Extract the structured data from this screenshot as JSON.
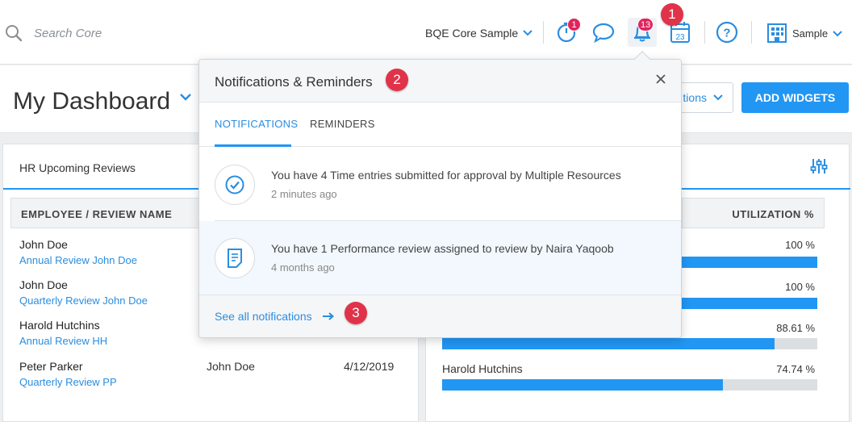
{
  "search": {
    "placeholder": "Search Core"
  },
  "header": {
    "company": "BQE Core Sample",
    "user": "Sample",
    "timer_badge": "1",
    "notif_badge": "13"
  },
  "callouts": {
    "one": "1",
    "two": "2",
    "three": "3"
  },
  "dashboard": {
    "title": "My Dashboard",
    "options_label": "tions",
    "add_widgets": "ADD WIDGETS"
  },
  "hr_widget": {
    "title": "HR Upcoming Reviews",
    "column_header": "EMPLOYEE / REVIEW NAME",
    "rows": [
      {
        "employee": "John Doe",
        "review": "Annual Review John Doe"
      },
      {
        "employee": "John Doe",
        "review": "Quarterly Review John Doe"
      },
      {
        "employee": "Harold Hutchins",
        "review": "Annual Review HH"
      },
      {
        "employee": "Peter Parker",
        "review": "Quarterly Review PP",
        "reviewer": "John Doe",
        "date": "4/12/2019"
      }
    ]
  },
  "util_widget": {
    "column_header": "UTILIZATION %",
    "rows": [
      {
        "name": "",
        "pct_label": "100 %",
        "pct": 100
      },
      {
        "name": "",
        "pct_label": "100 %",
        "pct": 100
      },
      {
        "name": "",
        "pct_label": "88.61 %",
        "pct": 88.61
      },
      {
        "name": "Harold Hutchins",
        "pct_label": "74.74 %",
        "pct": 74.74
      }
    ]
  },
  "popup": {
    "title": "Notifications & Reminders",
    "tabs": [
      "NOTIFICATIONS",
      "REMINDERS"
    ],
    "notifications": [
      {
        "message": "You have 4 Time entries submitted for approval by Multiple Resources",
        "time": "2 minutes ago",
        "icon": "check-circle-icon"
      },
      {
        "message": "You have 1 Performance review assigned to review by Naira Yaqoob",
        "time": "4 months ago",
        "icon": "document-icon"
      }
    ],
    "see_all": "See all notifications"
  },
  "colors": {
    "accent": "#2196f3",
    "callout": "#e0334a",
    "badge": "#e0245e"
  }
}
